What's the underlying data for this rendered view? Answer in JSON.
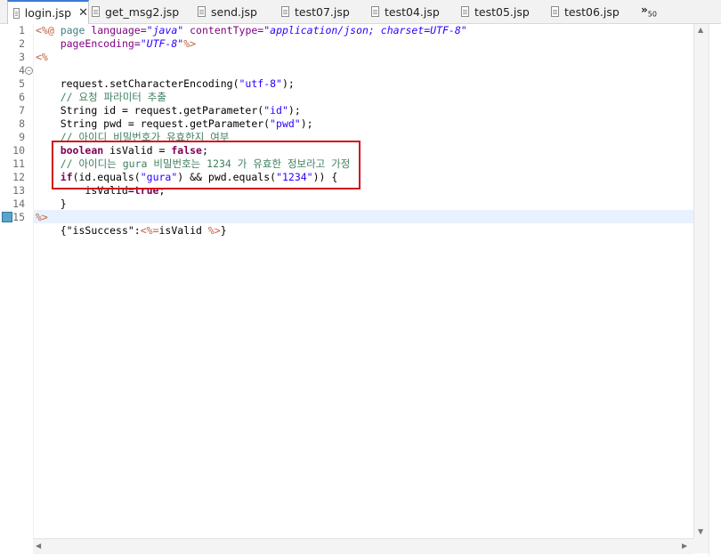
{
  "tabs": [
    {
      "label": "login.jsp",
      "active": true
    },
    {
      "label": "get_msg2.jsp",
      "active": false
    },
    {
      "label": "send.jsp",
      "active": false
    },
    {
      "label": "test07.jsp",
      "active": false
    },
    {
      "label": "test04.jsp",
      "active": false
    },
    {
      "label": "test05.jsp",
      "active": false
    },
    {
      "label": "test06.jsp",
      "active": false
    }
  ],
  "tab_close_glyph": "✕",
  "overflow": {
    "glyph": "»",
    "count": "50"
  },
  "line_numbers": [
    "1",
    "2",
    "3",
    "4",
    "5",
    "6",
    "7",
    "8",
    "9",
    "10",
    "11",
    "12",
    "13",
    "14",
    "15"
  ],
  "code": {
    "l1": {
      "open": "<%@ ",
      "kw_page": "page",
      "attr1": " language=",
      "v1": "\"java\"",
      "attr2": " contentType=",
      "v2": "\"application/json; charset=UTF-8\""
    },
    "l2": {
      "indent": "    ",
      "attr": "pageEncoding=",
      "v": "\"UTF-8\"",
      "close": "%>"
    },
    "l3": {
      "open": "<%"
    },
    "l4": {
      "text": ""
    },
    "l5": {
      "indent": "    ",
      "text1": "request.setCharacterEncoding(",
      "str": "\"utf-8\"",
      "text2": ");"
    },
    "l6": {
      "indent": "    ",
      "comment": "// 요청 파라미터 추출"
    },
    "l7": {
      "indent": "    ",
      "text1": "String id = request.getParameter(",
      "str": "\"id\"",
      "text2": ");"
    },
    "l8": {
      "indent": "    ",
      "text1": "String pwd = request.getParameter(",
      "str": "\"pwd\"",
      "text2": ");"
    },
    "l9": {
      "indent": "    ",
      "comment": "// 아이디 비밀번호가 유효한지 여부"
    },
    "l10": {
      "indent": "    ",
      "kw": "boolean",
      "text1": " isValid = ",
      "kw2": "false",
      "text2": ";"
    },
    "l11": {
      "indent": "    ",
      "comment": "// 아이디는 gura 비밀번호는 1234 가 유효한 정보라고 가정"
    },
    "l12": {
      "indent": "    ",
      "kw": "if",
      "text1": "(id.equals(",
      "str1": "\"gura\"",
      "text2": ") && pwd.equals(",
      "str2": "\"1234\"",
      "text3": ")) {"
    },
    "l13": {
      "indent": "        ",
      "text1": "isValid=",
      "kw": "true",
      "text2": ";"
    },
    "l14": {
      "indent": "    ",
      "text": "}"
    },
    "l15": {
      "close": "%>"
    },
    "l16": {
      "indent": "    ",
      "text1": "{\"isSuccess\":",
      "jsp_open": "<%=",
      "text2": "isValid ",
      "jsp_close": "%>",
      "text3": "}"
    }
  },
  "colors": {
    "keyword": "#7f0055",
    "jsp_tag": "#bf5f3f",
    "attribute": "#7f007f",
    "string": "#2a00ff",
    "comment": "#3f7f5f",
    "highlight_box": "#d0101c",
    "current_line": "#e8f2fe",
    "active_tab_accent": "#3c7bd6"
  }
}
